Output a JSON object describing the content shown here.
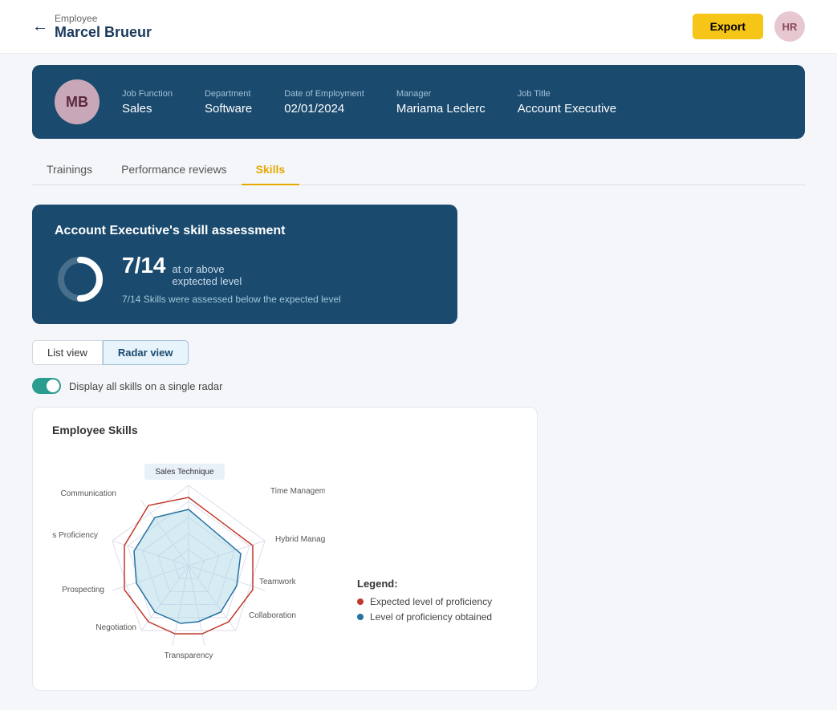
{
  "topbar": {
    "back_label": "Employee",
    "employee_name": "Marcel Brueur",
    "export_label": "Export",
    "avatar_initials": "HR"
  },
  "infobar": {
    "avatar_initials": "MB",
    "fields": [
      {
        "label": "Job Function",
        "value": "Sales"
      },
      {
        "label": "Department",
        "value": "Software"
      },
      {
        "label": "Date of Employment",
        "value": "02/01/2024"
      },
      {
        "label": "Manager",
        "value": "Mariama Leclerc"
      },
      {
        "label": "Job Title",
        "value": "Account Executive"
      }
    ]
  },
  "tabs": [
    {
      "label": "Trainings",
      "active": false
    },
    {
      "label": "Performance reviews",
      "active": false
    },
    {
      "label": "Skills",
      "active": true
    }
  ],
  "skillSummary": {
    "title": "Account Executive's skill assessment",
    "fraction": "7/14",
    "desc_top": "at or above",
    "desc_top2": "exptected level",
    "desc_bottom": "7/14 Skills were assessed below the expected level"
  },
  "viewToggle": {
    "list_label": "List view",
    "radar_label": "Radar view",
    "active": "radar"
  },
  "toggle": {
    "label": "Display all skills on a single radar",
    "enabled": true
  },
  "radarCard": {
    "title": "Employee Skills",
    "labels": [
      "Sales Technique",
      "Time Management",
      "Hybrid Management",
      "Teamwork",
      "Collaboration",
      "Transparency",
      "Negotiation",
      "Prospecting",
      "Sales Process Proficiency",
      "Communication"
    ]
  },
  "legend": {
    "title": "Legend:",
    "items": [
      {
        "color": "red",
        "label": "Expected level of proficiency"
      },
      {
        "color": "blue",
        "label": "Level of proficiency obtained"
      }
    ]
  }
}
